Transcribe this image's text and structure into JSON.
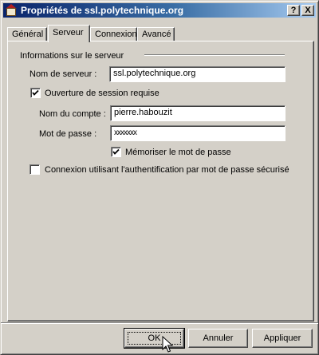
{
  "window": {
    "title": "Propriétés de ssl.polytechnique.org",
    "help_label": "?",
    "close_label": "X"
  },
  "tabs": [
    {
      "label": "Général",
      "active": false
    },
    {
      "label": "Serveur",
      "active": true
    },
    {
      "label": "Connexion",
      "active": false
    },
    {
      "label": "Avancé",
      "active": false
    }
  ],
  "server_group": {
    "title": "Informations sur le serveur",
    "server_name_label": "Nom de serveur :",
    "server_name_value": "ssl.polytechnique.org",
    "login_required_label": "Ouverture de session requise",
    "login_required_checked": true,
    "account_name_label": "Nom du compte :",
    "account_name_value": "pierre.habouzit",
    "password_label": "Mot de passe :",
    "password_value": "xxxxxxx",
    "remember_password_label": "Mémoriser le mot de passe",
    "remember_password_checked": true,
    "secure_auth_label": "Connexion utilisant l'authentification par mot de passe sécurisé",
    "secure_auth_checked": false
  },
  "buttons": {
    "ok": "OK",
    "cancel": "Annuler",
    "apply": "Appliquer"
  },
  "colors": {
    "dialog_face": "#d4d0c8",
    "titlebar_start": "#0a246a",
    "titlebar_end": "#a6caf0"
  }
}
